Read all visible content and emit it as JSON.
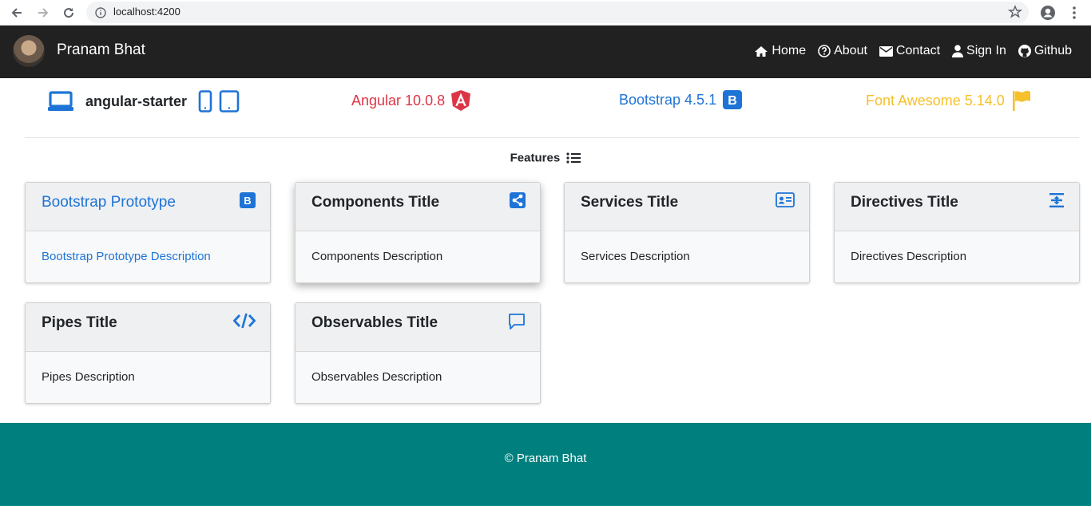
{
  "browser": {
    "url": "localhost:4200"
  },
  "navbar": {
    "brand": "Pranam Bhat",
    "links": [
      {
        "label": "Home",
        "icon": "home-icon"
      },
      {
        "label": "About",
        "icon": "question-circle-icon"
      },
      {
        "label": "Contact",
        "icon": "envelope-icon"
      },
      {
        "label": "Sign In",
        "icon": "user-icon"
      },
      {
        "label": "Github",
        "icon": "github-icon"
      }
    ]
  },
  "tech": {
    "app": "angular-starter",
    "angular": "Angular 10.0.8",
    "bootstrap": "Bootstrap 4.5.1",
    "fontawesome": "Font Awesome 5.14.0"
  },
  "features_label": "Features",
  "cards": [
    {
      "title": "Bootstrap Prototype",
      "desc": "Bootstrap Prototype Description",
      "icon": "bootstrap-icon"
    },
    {
      "title": "Components Title",
      "desc": "Components Description",
      "icon": "share-icon"
    },
    {
      "title": "Services Title",
      "desc": "Services Description",
      "icon": "id-card-icon"
    },
    {
      "title": "Directives Title",
      "desc": "Directives Description",
      "icon": "text-height-icon"
    },
    {
      "title": "Pipes Title",
      "desc": "Pipes Description",
      "icon": "code-icon"
    },
    {
      "title": "Observables Title",
      "desc": "Observables Description",
      "icon": "comment-icon"
    }
  ],
  "footer": {
    "copyright": "© Pranam Bhat"
  },
  "colors": {
    "navbar": "#212121",
    "footer": "#007f7f",
    "primary": "#1e74d6",
    "danger": "#dc3545",
    "warning": "#f6c02b"
  }
}
